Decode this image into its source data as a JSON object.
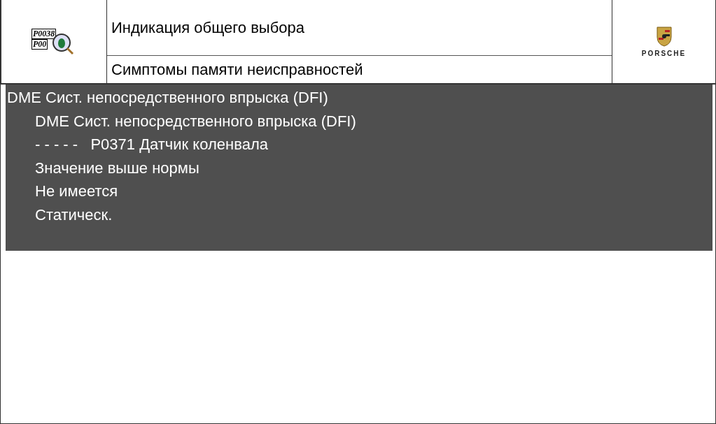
{
  "header": {
    "icon_codes": [
      "P0038",
      "P00"
    ],
    "title": "Индикация общего выбора",
    "subtitle": "Симптомы памяти неисправностей",
    "logo_text": "PORSCHE"
  },
  "tree": [
    {
      "text": "DME Сист. непосредственного впрыска (DFI)",
      "children": [
        {
          "text": "DME Сист. непосредственного впрыска (DFI)"
        },
        {
          "text": "- - - - -   P0371 Датчик коленвала"
        },
        {
          "text": "Значение выше нормы"
        },
        {
          "text": "Не имеется"
        },
        {
          "text": "Статическ."
        }
      ]
    }
  ]
}
